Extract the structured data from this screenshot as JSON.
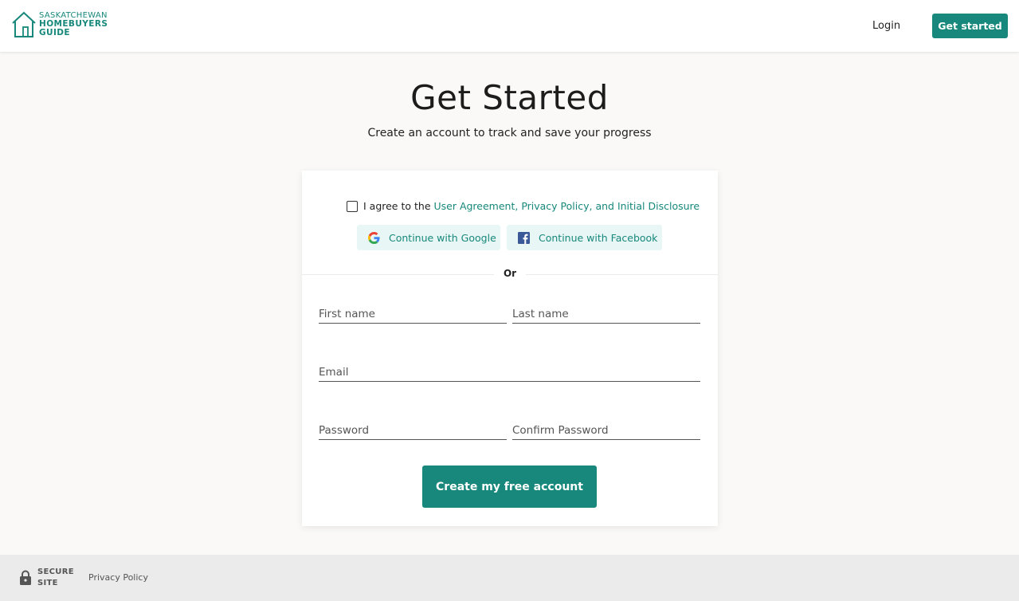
{
  "header": {
    "logo": {
      "line1": "SASKATCHEWAN",
      "line2": "HOMEBUYERS",
      "line3": "GUIDE"
    },
    "login_label": "Login",
    "get_started_label": "Get started"
  },
  "main": {
    "title": "Get Started",
    "subtitle": "Create an account to track and save your progress"
  },
  "form": {
    "agree_prefix": "I agree to the ",
    "agree_link": "User Agreement, Privacy Policy, and Initial Disclosure",
    "google_label": "Continue with Google",
    "facebook_label": "Continue with Facebook",
    "or_label": "Or",
    "fields": {
      "first_name": {
        "placeholder": "First name",
        "value": ""
      },
      "last_name": {
        "placeholder": "Last name",
        "value": ""
      },
      "email": {
        "placeholder": "Email",
        "value": ""
      },
      "password": {
        "placeholder": "Password",
        "value": ""
      },
      "confirm_password": {
        "placeholder": "Confirm Password",
        "value": ""
      }
    },
    "submit_label": "Create my free account"
  },
  "footer": {
    "secure_line1": "SECURE",
    "secure_line2": "SITE",
    "privacy_label": "Privacy Policy"
  },
  "colors": {
    "brand": "#17887b",
    "social_bg": "#e8f6f5",
    "page_bg": "#faf9f7",
    "footer_bg": "#ebebeb"
  },
  "icons": {
    "logo": "house-icon",
    "google": "google-icon",
    "facebook": "facebook-icon",
    "secure": "lock-icon"
  }
}
